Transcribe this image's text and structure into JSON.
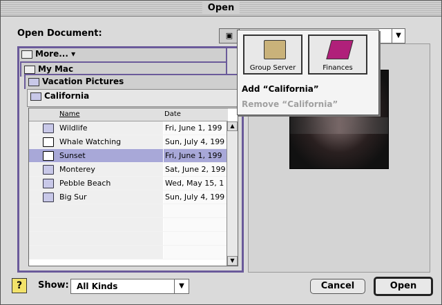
{
  "window": {
    "title": "Open"
  },
  "open_label": "Open Document:",
  "folder_tabs": {
    "more": "More...",
    "my_mac": "My Mac",
    "vacation": "Vacation Pictures",
    "current": "California"
  },
  "list": {
    "col_name": "Name",
    "col_date": "Date",
    "rows": [
      {
        "name": "Wildlife",
        "date": "Fri, June 1, 199",
        "type": "folder"
      },
      {
        "name": "Whale Watching",
        "date": "Sun, July 4, 199",
        "type": "doc"
      },
      {
        "name": "Sunset",
        "date": "Fri, June 1, 199",
        "type": "doc"
      },
      {
        "name": "Monterey",
        "date": "Sat, June 2, 199",
        "type": "folder"
      },
      {
        "name": "Pebble Beach",
        "date": "Wed, May 15, 1",
        "type": "folder"
      },
      {
        "name": "Big Sur",
        "date": "Sun, July 4, 199",
        "type": "folder"
      }
    ],
    "selected_index": 2
  },
  "favorites_menu": {
    "items": [
      {
        "label": "Group Server",
        "icon": "server-icon"
      },
      {
        "label": "Finances",
        "icon": "book-icon"
      }
    ],
    "add_label": "Add “California”",
    "remove_label": "Remove “California”"
  },
  "show": {
    "label": "Show:",
    "value": "All Kinds"
  },
  "buttons": {
    "help": "?",
    "cancel": "Cancel",
    "open": "Open"
  }
}
